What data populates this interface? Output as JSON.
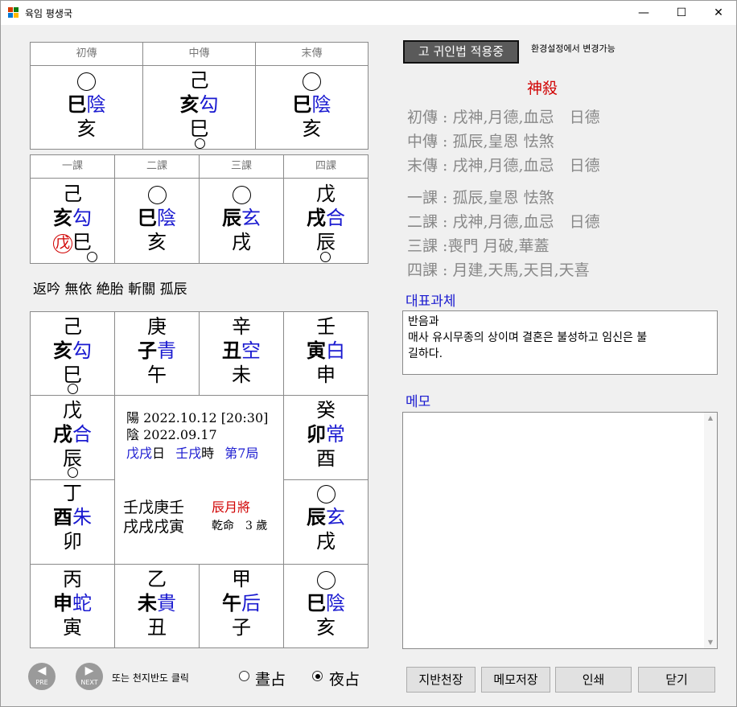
{
  "window": {
    "title": "육임 평생국",
    "min": "—",
    "max": "☐",
    "close": "✕"
  },
  "mode_button": "고 귀인법 적용중",
  "mode_hint": "환경설정에서 변경가능",
  "transmissions": {
    "headers": [
      "初傳",
      "中傳",
      "末傳"
    ],
    "cells": [
      {
        "l1": "",
        "l2a": "巳",
        "l2b": "陰",
        "l3": "亥"
      },
      {
        "l1": "己",
        "l2a": "亥",
        "l2b": "勾",
        "l3": "巳"
      },
      {
        "l1": "",
        "l2a": "巳",
        "l2b": "陰",
        "l3": "亥"
      }
    ]
  },
  "lessons": {
    "headers": [
      "一課",
      "二課",
      "三課",
      "四課"
    ],
    "cells": [
      {
        "l1": "己",
        "l2a": "亥",
        "l2b": "勾",
        "l3a": "戊",
        "l3b": "巳"
      },
      {
        "l1": "",
        "l2a": "巳",
        "l2b": "陰",
        "l3": "亥"
      },
      {
        "l1": "",
        "l2a": "辰",
        "l2b": "玄",
        "l3": "戌"
      },
      {
        "l1": "戊",
        "l2a": "戌",
        "l2b": "合",
        "l3": "辰"
      }
    ]
  },
  "patterns": "返吟 無依 絶胎 斬關 孤辰",
  "board": {
    "top": [
      {
        "l1": "己",
        "l2a": "亥",
        "l2b": "勾",
        "l3": "巳"
      },
      {
        "l1": "庚",
        "l2a": "子",
        "l2b": "青",
        "l3": "午"
      },
      {
        "l1": "辛",
        "l2a": "丑",
        "l2b": "空",
        "l3": "未"
      },
      {
        "l1": "壬",
        "l2a": "寅",
        "l2b": "白",
        "l3": "申"
      }
    ],
    "left": [
      {
        "l1": "戊",
        "l2a": "戌",
        "l2b": "合",
        "l3": "辰"
      },
      {
        "l1": "丁",
        "l2a": "酉",
        "l2b": "朱",
        "l3": "卯"
      }
    ],
    "right": [
      {
        "l1": "癸",
        "l2a": "卯",
        "l2b": "常",
        "l3": "酉"
      },
      {
        "l1": "",
        "l2a": "辰",
        "l2b": "玄",
        "l3": "戌"
      }
    ],
    "bottom": [
      {
        "l1": "丙",
        "l2a": "申",
        "l2b": "蛇",
        "l3": "寅"
      },
      {
        "l1": "乙",
        "l2a": "未",
        "l2b": "貴",
        "l3": "丑"
      },
      {
        "l1": "甲",
        "l2a": "午",
        "l2b": "后",
        "l3": "子"
      },
      {
        "l1": "",
        "l2a": "巳",
        "l2b": "陰",
        "l3": "亥"
      }
    ],
    "center": {
      "solar": "陽 2022.10.12 [20:30]",
      "lunar": "陰 2022.09.17",
      "day_ganji": "戊戌",
      "day_label": "日",
      "hour_ganji": "壬戌",
      "hour_label": "時",
      "ju": "第7局",
      "pillars_top": "壬戊庚壬",
      "pillars_bottom": "戌戌戌寅",
      "month_general": "辰月將",
      "destiny": "乾命　3 歲"
    }
  },
  "shensha": {
    "title": "神殺",
    "rows": [
      {
        "label": "初傳 :",
        "text": "戌神,月德,血忌　日德"
      },
      {
        "label": "中傳 :",
        "text": "孤辰,皇恩 怯煞"
      },
      {
        "label": "末傳 :",
        "text": "戌神,月德,血忌　日德"
      },
      {
        "label": "一課 :",
        "text": "孤辰,皇恩 怯煞"
      },
      {
        "label": "二課 :",
        "text": "戌神,月德,血忌　日德"
      },
      {
        "label": "三課 :",
        "text": "喪門 月破,華蓋"
      },
      {
        "label": "四課 :",
        "text": "月建,天馬,天目,天喜"
      }
    ]
  },
  "representative": {
    "label": "대표과체",
    "line1": "반음과",
    "line2": "매사 유시무종의 상이며 결혼은 불성하고 임신은 불",
    "line3": "길하다."
  },
  "memo": {
    "label": "메모",
    "value": ""
  },
  "nav": {
    "prev": "PRE",
    "next": "NEXT",
    "hint": "또는 천지반도 클릭"
  },
  "radios": {
    "day": "晝占",
    "night": "夜占",
    "selected": "night"
  },
  "buttons": {
    "board": "지반천장",
    "save_memo": "메모저장",
    "print": "인쇄",
    "close": "닫기"
  }
}
